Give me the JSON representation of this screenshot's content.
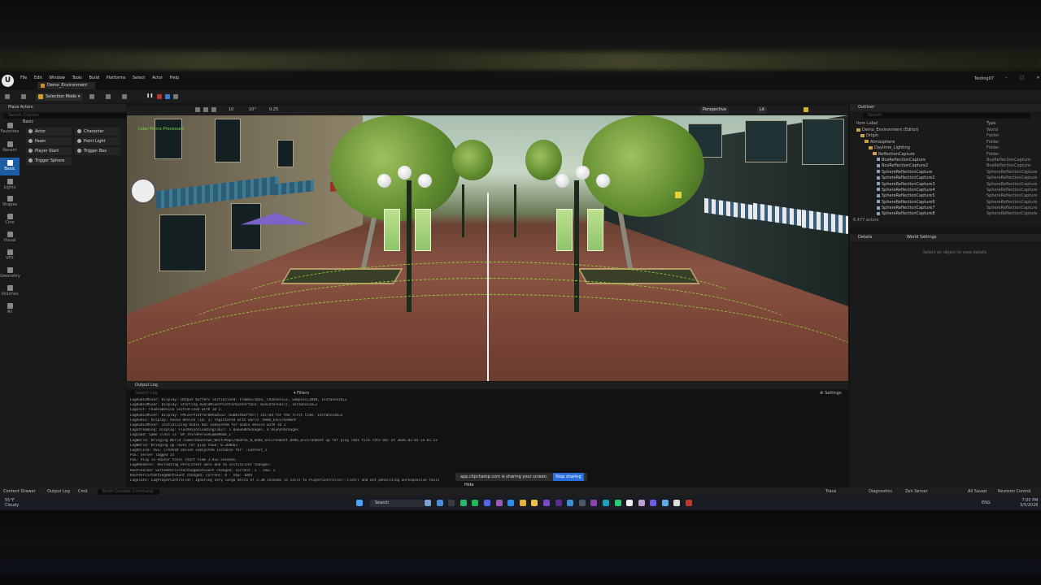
{
  "title": {
    "app_name": "Testing07",
    "tab": "Demo_Environment"
  },
  "menu": [
    "File",
    "Edit",
    "Window",
    "Tools",
    "Build",
    "Platforms",
    "Select",
    "Actor",
    "Help"
  ],
  "toolbar": {
    "mode": "Selection Mode",
    "perspective": "Perspective",
    "lit": "Lit",
    "grid_value": "10",
    "angle_value": "10°",
    "scale_value": "0.25"
  },
  "place_actors": {
    "title": "Place Actors",
    "search_placeholder": "Search Classes",
    "category": "Basic",
    "sidebar": [
      "Favorites",
      "Recent",
      "Basic",
      "Lights",
      "Shapes",
      "Cine",
      "Visual",
      "VFX",
      "Geometry",
      "Volumes",
      "All"
    ],
    "items": [
      "Actor",
      "Character",
      "Pawn",
      "Point Light",
      "Player Start",
      "Trigger Box",
      "Trigger Sphere"
    ]
  },
  "viewport": {
    "overlay_line1": "Lidar Points Processed",
    "overlay_line2": ""
  },
  "outliner": {
    "title": "Outliner",
    "search_placeholder": "Search",
    "col_label": "Item Label",
    "col_type": "Type",
    "rows": [
      {
        "label": "Demo_Environment (Editor)",
        "type": "World",
        "kind": "world"
      },
      {
        "label": "Origin",
        "type": "Folder",
        "kind": "folder"
      },
      {
        "label": "Atmosphere",
        "type": "Folder",
        "kind": "folder"
      },
      {
        "label": "Daytime_Lighting",
        "type": "Folder",
        "kind": "folder"
      },
      {
        "label": "ReflectionCapture",
        "type": "Folder",
        "kind": "folder"
      },
      {
        "label": "BoxReflectionCapture",
        "type": "BoxReflectionCapture",
        "kind": "actor"
      },
      {
        "label": "BoxReflectionCapture2",
        "type": "BoxReflectionCapture",
        "kind": "actor"
      },
      {
        "label": "SphereReflectionCapture",
        "type": "SphereReflectionCapture",
        "kind": "actor"
      },
      {
        "label": "SphereReflectionCapture2",
        "type": "SphereReflectionCapture",
        "kind": "actor"
      },
      {
        "label": "SphereReflectionCapture3",
        "type": "SphereReflectionCapture",
        "kind": "actor"
      },
      {
        "label": "SphereReflectionCapture4",
        "type": "SphereReflectionCapture",
        "kind": "actor"
      },
      {
        "label": "SphereReflectionCapture5",
        "type": "SphereReflectionCapture",
        "kind": "actor"
      },
      {
        "label": "SphereReflectionCapture6",
        "type": "SphereReflectionCapture",
        "kind": "actor"
      },
      {
        "label": "SphereReflectionCapture7",
        "type": "SphereReflectionCapture",
        "kind": "actor"
      },
      {
        "label": "SphereReflectionCapture8",
        "type": "SphereReflectionCapture",
        "kind": "actor"
      }
    ],
    "actor_count": "6,477 actors"
  },
  "details": {
    "tab_details": "Details",
    "tab_world": "World Settings",
    "empty_msg": "Select an object to view details"
  },
  "output_log": {
    "title": "Output Log",
    "search_placeholder": "Search Log",
    "filters": "Filters",
    "settings": "Settings",
    "lines": [
      "LogAudioMixer: Display: Output buffers initialized: Frames=1024, Channels=2, Samples=2048, InstanceID=2",
      "LogAudioMixer: Display: Starting AudioMixerPlatformInterface: RunInternal(), InstanceID=2",
      "LogInit: FAudioDevice initialized with ID 2.",
      "LogAudioMixer: Display: FMixerPlatformXAudio2::SubmitBuffer() called for the first time. InstanceID=2",
      "LogAudio: Display: Audio Device (ID: 2) registered with world 'Demo_Environment'.",
      "LogAudioMixer: Initializing Audio Bus Subsystem for audio device with ID 2",
      "LogStreaming: Display: FlushAsyncLoading(362): 1 QueuedPackages, 0 AsyncPackages",
      "LogLoad: Game class is 'BP_ThirdPersonGameMode_C'",
      "LogWorld: Bringing World /Game/Downtown_West/Maps/UEDPIE_0_Demo_Environment.Demo_Environment up for play (max tick rate 60) at 2026.03.05-14.03.13",
      "LogWorld: Bringing up level for play took: 0.268663",
      "LogOnline: OSS: Created online subsystem instance for: :Context_1",
      "PIE: Server logged in",
      "PIE: Play in editor total start time 1.932 seconds.",
      "LogRenderer: Recreating Persistent SBTs due to initializer changes:",
      "    RootChecker SortedPersistentSegmentCount changed: current: 1 - new: 2",
      "    RootPersistentSegmentCount changed: current: 0 - new: 1044",
      "LogSlate: LogPlayerController: Ignoring very large delta of 2.38 seconds in calls to PlayerController::Tick() and not penalizing unresponsive tools"
    ]
  },
  "share_bar": {
    "text": "app.clipchamp.com is sharing your screen.",
    "stop": "Stop sharing",
    "hide": "Hide"
  },
  "status_bar": {
    "content_drawer": "Content Drawer",
    "output_log": "Output Log",
    "cmd": "Cmd",
    "cmd_placeholder": "Enter Console Command",
    "trace": "Trace",
    "derived_data": "Diagnostics",
    "source_control": "Zen Server",
    "all_saved": "All Saved",
    "revision": "Revision Control"
  },
  "taskbar": {
    "weather_temp": "55°F",
    "weather_desc": "Cloudy",
    "search": "Search",
    "lang": "ENG",
    "time": "7:00 PM",
    "date": "3/5/2026"
  }
}
